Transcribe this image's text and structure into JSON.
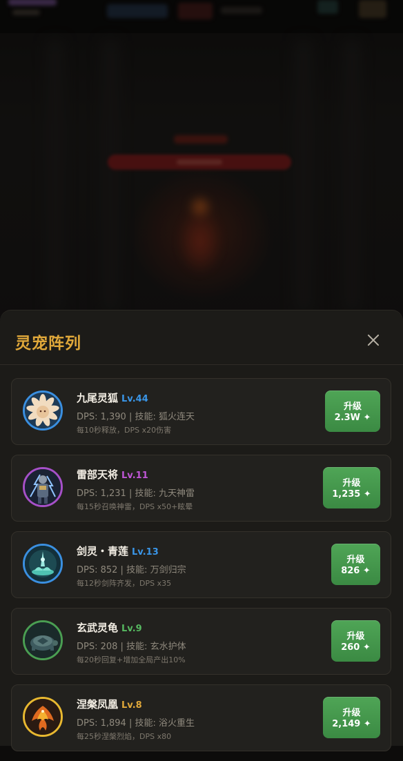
{
  "panel": {
    "title": "灵宠阵列"
  },
  "colors": {
    "title": "#e0a83a",
    "level_blue": "#3a96e8",
    "level_purple": "#c056d8",
    "level_green": "#56b860",
    "button_green": "#46994d"
  },
  "pets": [
    {
      "name": "九尾灵狐",
      "level": "Lv.44",
      "level_color": "#3a96e8",
      "ring_color": "#3a8fe0",
      "icon": "nine-tailed-fox-icon",
      "stats": "DPS: 1,390 | 技能: 狐火连天",
      "desc": "每10秒释放，DPS x20伤害",
      "upgrade_label": "升级",
      "upgrade_cost": "2.3W ✦"
    },
    {
      "name": "雷部天将",
      "level": "Lv.11",
      "level_color": "#c056d8",
      "ring_color": "#a650c8",
      "icon": "thunder-general-icon",
      "stats": "DPS: 1,231 | 技能: 九天神雷",
      "desc": "每15秒召唤神雷，DPS x50+眩晕",
      "upgrade_label": "升级",
      "upgrade_cost": "1,235 ✦"
    },
    {
      "name": "剑灵・青莲",
      "level": "Lv.13",
      "level_color": "#3a96e8",
      "ring_color": "#3a8fe0",
      "icon": "sword-spirit-lotus-icon",
      "stats": "DPS: 852 | 技能: 万剑归宗",
      "desc": "每12秒剑阵齐发，DPS x35",
      "upgrade_label": "升级",
      "upgrade_cost": "826 ✦"
    },
    {
      "name": "玄武灵龟",
      "level": "Lv.9",
      "level_color": "#56b860",
      "ring_color": "#4a9e52",
      "icon": "black-tortoise-icon",
      "stats": "DPS: 208 | 技能: 玄水护体",
      "desc": "每20秒回复+增加全局产出10%",
      "upgrade_label": "升级",
      "upgrade_cost": "260 ✦"
    },
    {
      "name": "涅槃凤凰",
      "level": "Lv.8",
      "level_color": "#e0a83a",
      "ring_color": "#e8b830",
      "icon": "phoenix-icon",
      "stats": "DPS: 1,894 | 技能: 浴火重生",
      "desc": "每25秒涅槃烈焰，DPS x80",
      "upgrade_label": "升级",
      "upgrade_cost": "2,149 ✦"
    }
  ]
}
